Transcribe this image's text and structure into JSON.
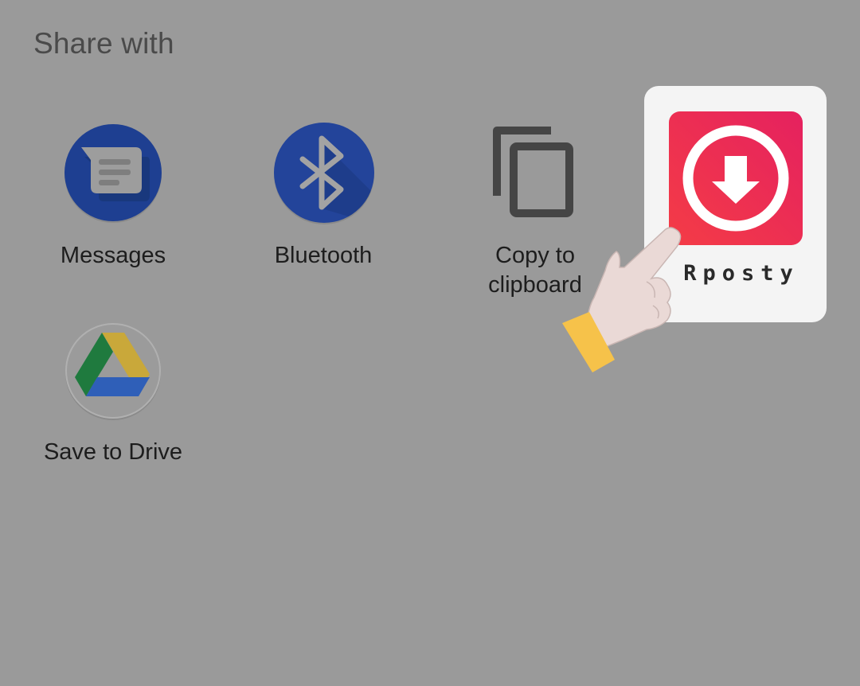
{
  "sheet": {
    "title": "Share with"
  },
  "targets": [
    {
      "label": "Messages",
      "icon": "messages-icon"
    },
    {
      "label": "Bluetooth",
      "icon": "bluetooth-icon"
    },
    {
      "label_line1": "Copy to",
      "label_line2": "clipboard",
      "icon": "copy-icon"
    },
    {
      "label": "Rposty",
      "icon": "rposty-download-icon"
    },
    {
      "label": "Save to Drive",
      "icon": "google-drive-icon"
    }
  ],
  "colors": {
    "background": "#9a9a9a",
    "messages_blue": "#1e3f91",
    "bluetooth_blue": "#23449a",
    "rposty_red": "#ef2f55",
    "card_bg": "#f4f4f4",
    "cuff_yellow": "#f6c24a"
  }
}
